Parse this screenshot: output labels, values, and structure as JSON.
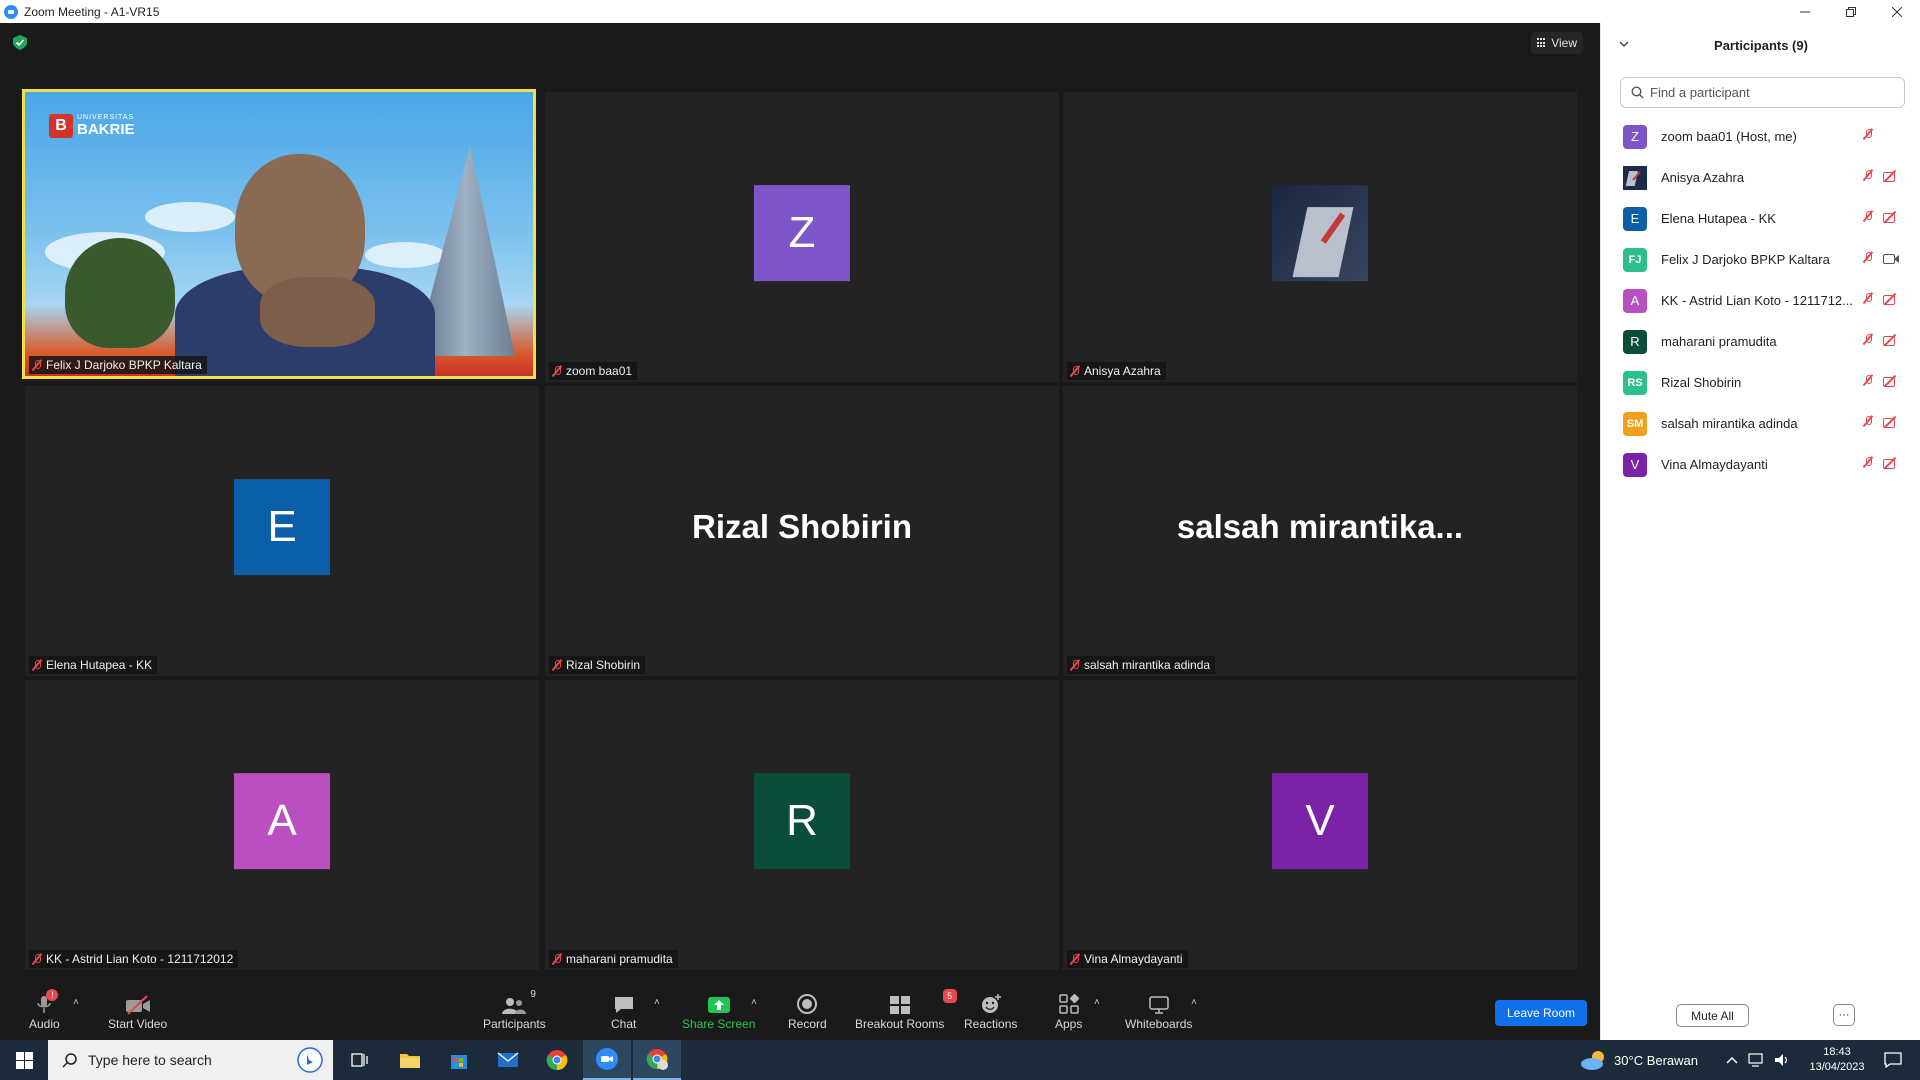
{
  "window": {
    "title": "Zoom Meeting - A1-VR15"
  },
  "meeting": {
    "view_label": "View",
    "tiles": [
      {
        "label": "Felix J Darjoko BPKP Kaltara",
        "type": "video",
        "logo_small": "UNIVERSITAS",
        "logo_big": "BAKRIE",
        "logo_letter": "B"
      },
      {
        "label": "zoom baa01",
        "type": "avatar",
        "letter": "Z",
        "color": "#7c55c7"
      },
      {
        "label": "Anisya Azahra",
        "type": "picture"
      },
      {
        "label": "Elena Hutapea - KK",
        "type": "avatar",
        "letter": "E",
        "color": "#0a5fa8"
      },
      {
        "label": "Rizal Shobirin",
        "type": "name",
        "display": "Rizal Shobirin"
      },
      {
        "label": "salsah mirantika adinda",
        "type": "name",
        "display": "salsah  mirantika..."
      },
      {
        "label": "KK - Astrid Lian Koto - 1211712012",
        "type": "avatar",
        "letter": "A",
        "color": "#b94fc1"
      },
      {
        "label": "maharani pramudita",
        "type": "avatar",
        "letter": "R",
        "color": "#0b4d3b"
      },
      {
        "label": "Vina Almaydayanti",
        "type": "avatar",
        "letter": "V",
        "color": "#7a22a8"
      }
    ]
  },
  "toolbar": {
    "audio": "Audio",
    "audio_badge": "!",
    "start_video": "Start Video",
    "participants": "Participants",
    "participants_count": "9",
    "chat": "Chat",
    "share_screen": "Share Screen",
    "record": "Record",
    "breakout_rooms": "Breakout Rooms",
    "breakout_badge": "5",
    "reactions": "Reactions",
    "apps": "Apps",
    "whiteboards": "Whiteboards",
    "leave_room": "Leave Room"
  },
  "panel": {
    "title": "Participants (9)",
    "search_placeholder": "Find a participant",
    "participants": [
      {
        "name": "zoom baa01 (Host, me)",
        "initials": "Z",
        "color": "#7c55c7",
        "camera": "none"
      },
      {
        "name": "Anisya Azahra",
        "initials": "",
        "color": "#1d2a4a",
        "camera": "off"
      },
      {
        "name": "Elena Hutapea - KK",
        "initials": "E",
        "color": "#0a5fa8",
        "camera": "off"
      },
      {
        "name": "Felix J Darjoko BPKP Kaltara",
        "initials": "FJ",
        "color": "#2dbf8f",
        "camera": "on"
      },
      {
        "name": "KK - Astrid Lian Koto - 1211712...",
        "initials": "A",
        "color": "#b94fc1",
        "camera": "off"
      },
      {
        "name": "maharani pramudita",
        "initials": "R",
        "color": "#0b4d3b",
        "camera": "off"
      },
      {
        "name": "Rizal Shobirin",
        "initials": "RS",
        "color": "#2dbf8f",
        "camera": "off"
      },
      {
        "name": "salsah mirantika adinda",
        "initials": "SM",
        "color": "#f0a21c",
        "camera": "off"
      },
      {
        "name": "Vina Almaydayanti",
        "initials": "V",
        "color": "#7a22a8",
        "camera": "off"
      }
    ],
    "mute_all": "Mute All",
    "more": "···"
  },
  "taskbar": {
    "search_placeholder": "Type here to search",
    "weather": "30°C  Berawan",
    "time": "18:43",
    "date": "13/04/2023"
  }
}
